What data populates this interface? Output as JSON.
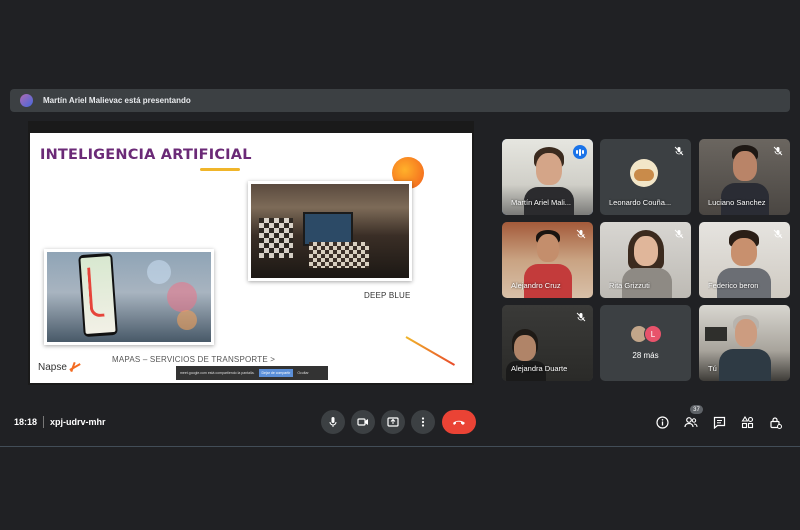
{
  "presenting": {
    "text": "Martín Ariel Malievac está presentando"
  },
  "slide": {
    "title": "INTELIGENCIA ARTIFICIAL",
    "caption_chess": "DEEP BLUE",
    "caption_map": "MAPAS – SERVICIOS DE TRANSPORTE >",
    "logo_text": "Napse",
    "share_notice": {
      "text": "meet.google.com está compartiendo la pantalla.",
      "stop_label": "Dejar de compartir",
      "hide_label": "Ocultar"
    }
  },
  "participants": [
    {
      "name": "Martín Ariel Mali...",
      "speaking": true
    },
    {
      "name": "Leonardo Couña...",
      "muted": true
    },
    {
      "name": "Luciano Sanchez",
      "muted": true
    },
    {
      "name": "Alejandro Cruz",
      "muted": true
    },
    {
      "name": "Rita Grizzuti",
      "muted": true
    },
    {
      "name": "Federico beron",
      "muted": true
    },
    {
      "name": "Alejandra Duarte",
      "muted": true
    },
    {
      "name": "28 más",
      "avatar_letter": "L"
    },
    {
      "name": "Tú"
    }
  ],
  "bottom_bar": {
    "time": "18:18",
    "meeting_code": "xpj-udrv-mhr",
    "people_count": "37"
  },
  "colors": {
    "background": "#202124",
    "tile": "#3c4043",
    "end_call": "#ea4335",
    "active_outline": "#8ab4f8",
    "slide_title": "#6b2a77"
  },
  "icons": {
    "mic": "microphone-icon",
    "camera": "camera-icon",
    "present": "present-screen-icon",
    "more": "more-options-icon",
    "end": "end-call-icon",
    "info": "info-icon",
    "people": "people-icon",
    "chat": "chat-icon",
    "activities": "activities-icon",
    "host": "host-controls-icon"
  }
}
